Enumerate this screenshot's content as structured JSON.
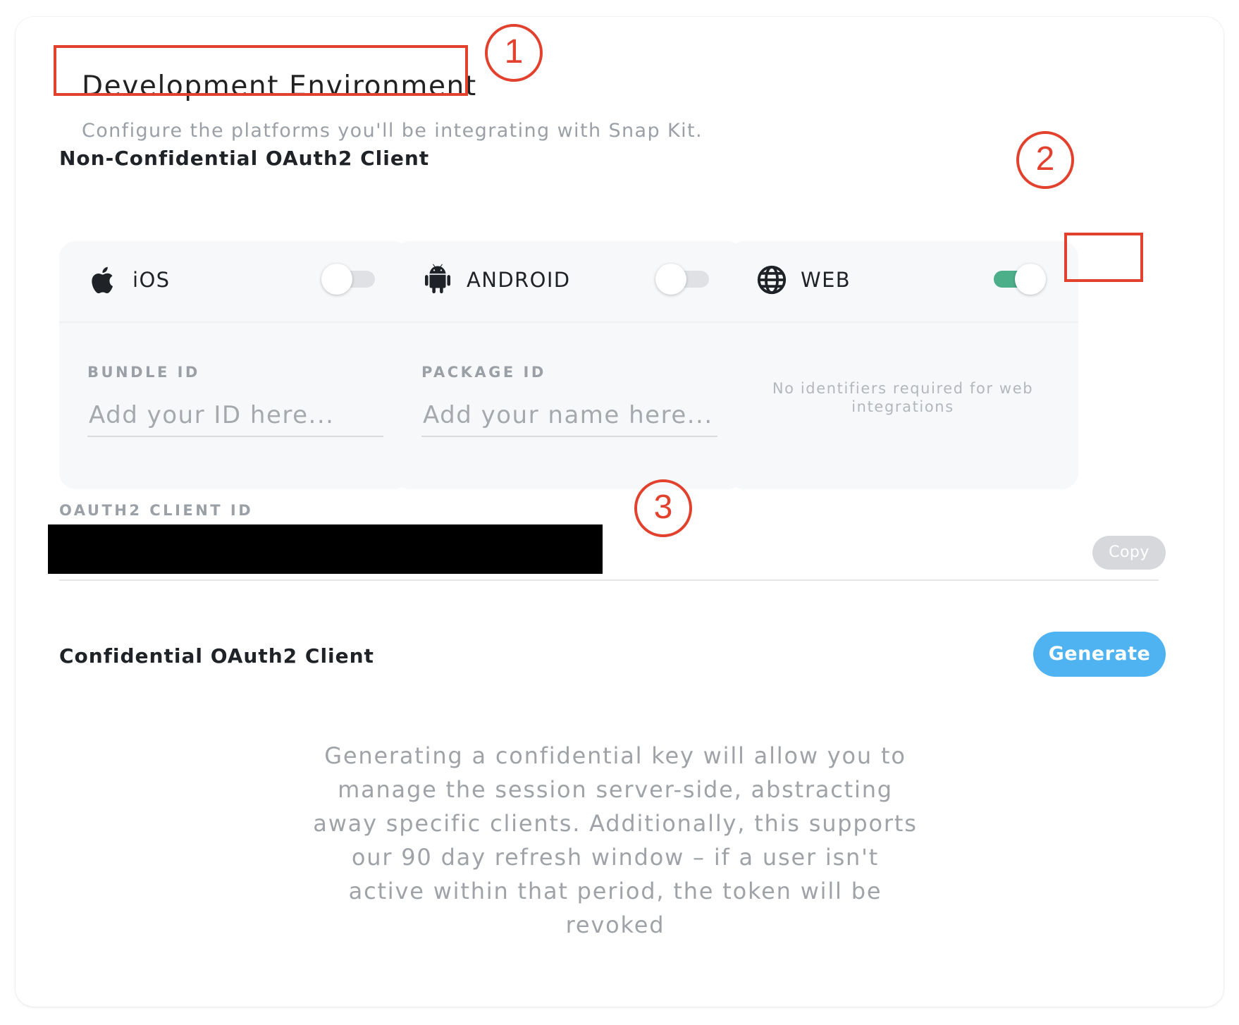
{
  "header": {
    "title": "Development Environment",
    "subtitle": "Configure the platforms you'll be integrating with Snap Kit."
  },
  "non_confidential": {
    "title": "Non-Confidential OAuth2 Client",
    "platforms": [
      {
        "name": "iOS",
        "icon": "apple-icon",
        "enabled": false,
        "field_label": "BUNDLE ID",
        "field_placeholder": "Add your ID here...",
        "field_value": ""
      },
      {
        "name": "ANDROID",
        "icon": "android-icon",
        "enabled": false,
        "field_label": "PACKAGE ID",
        "field_placeholder": "Add your name here...",
        "field_value": ""
      },
      {
        "name": "WEB",
        "icon": "globe-icon",
        "enabled": true,
        "note": "No identifiers required for web integrations"
      }
    ],
    "client_id_label": "OAUTH2 CLIENT ID",
    "client_id_redacted": true,
    "copy_label": "Copy"
  },
  "confidential": {
    "title": "Confidential OAuth2 Client",
    "generate_label": "Generate",
    "description": "Generating a confidential key will allow you to manage the session server-side, abstracting away specific clients. Additionally, this supports our 90 day refresh window – if a user isn't active within that period, the token will be revoked"
  },
  "annotations": [
    "1",
    "2",
    "3"
  ],
  "colors": {
    "toggle_on": "#4caf8a",
    "toggle_off": "#dfe1e4",
    "generate_button": "#4fb3f2",
    "copy_button": "#d6d8db",
    "annotation": "#e2412e"
  }
}
